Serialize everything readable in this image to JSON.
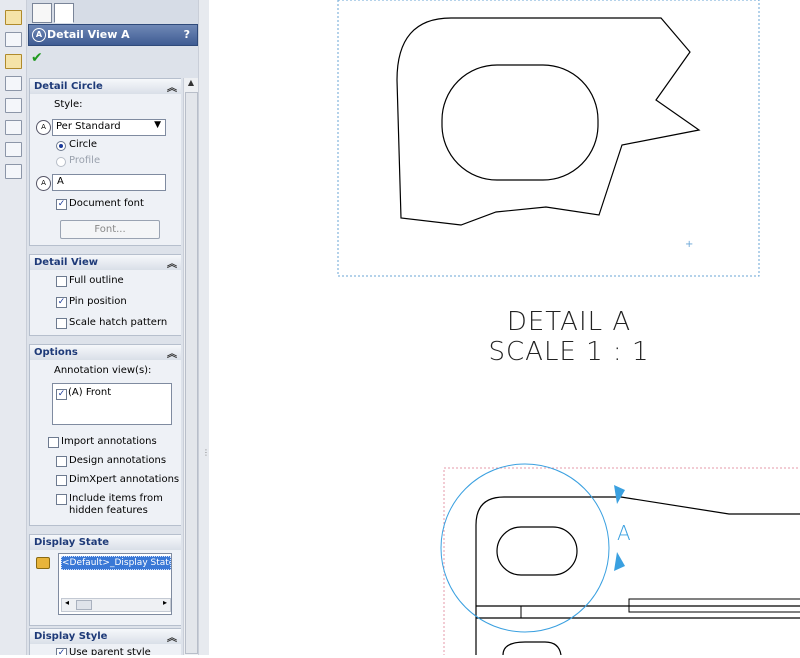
{
  "property_manager": {
    "title": "Detail View A",
    "help_label": "?",
    "detail_circle": {
      "heading": "Detail Circle",
      "style_label": "Style:",
      "style_value": "Per Standard",
      "circle_label": "Circle",
      "profile_label": "Profile",
      "label_value": "A",
      "document_font_label": "Document font",
      "font_button": "Font..."
    },
    "detail_view": {
      "heading": "Detail View",
      "full_outline": "Full outline",
      "pin_position": "Pin position",
      "scale_hatch": "Scale hatch pattern"
    },
    "options": {
      "heading": "Options",
      "annotation_views_label": "Annotation view(s):",
      "annotation_item": "(A) Front",
      "import_annotations": "Import annotations",
      "design_annotations": "Design annotations",
      "dimxpert_annotations": "DimXpert annotations",
      "include_items_line1": "Include items from",
      "include_items_line2": "hidden features"
    },
    "display_state": {
      "heading": "Display State",
      "item": "<Default>_Display State"
    },
    "display_style": {
      "heading": "Display Style",
      "use_parent": "Use parent style"
    }
  },
  "drawing": {
    "caption_line1": "DETAIL A",
    "caption_line2": "SCALE 1 : 1",
    "detail_letter": "A"
  },
  "colors": {
    "accent": "#3f5c93",
    "detail_circle": "#3aa0e0",
    "view_border": "#6aa6d6"
  }
}
